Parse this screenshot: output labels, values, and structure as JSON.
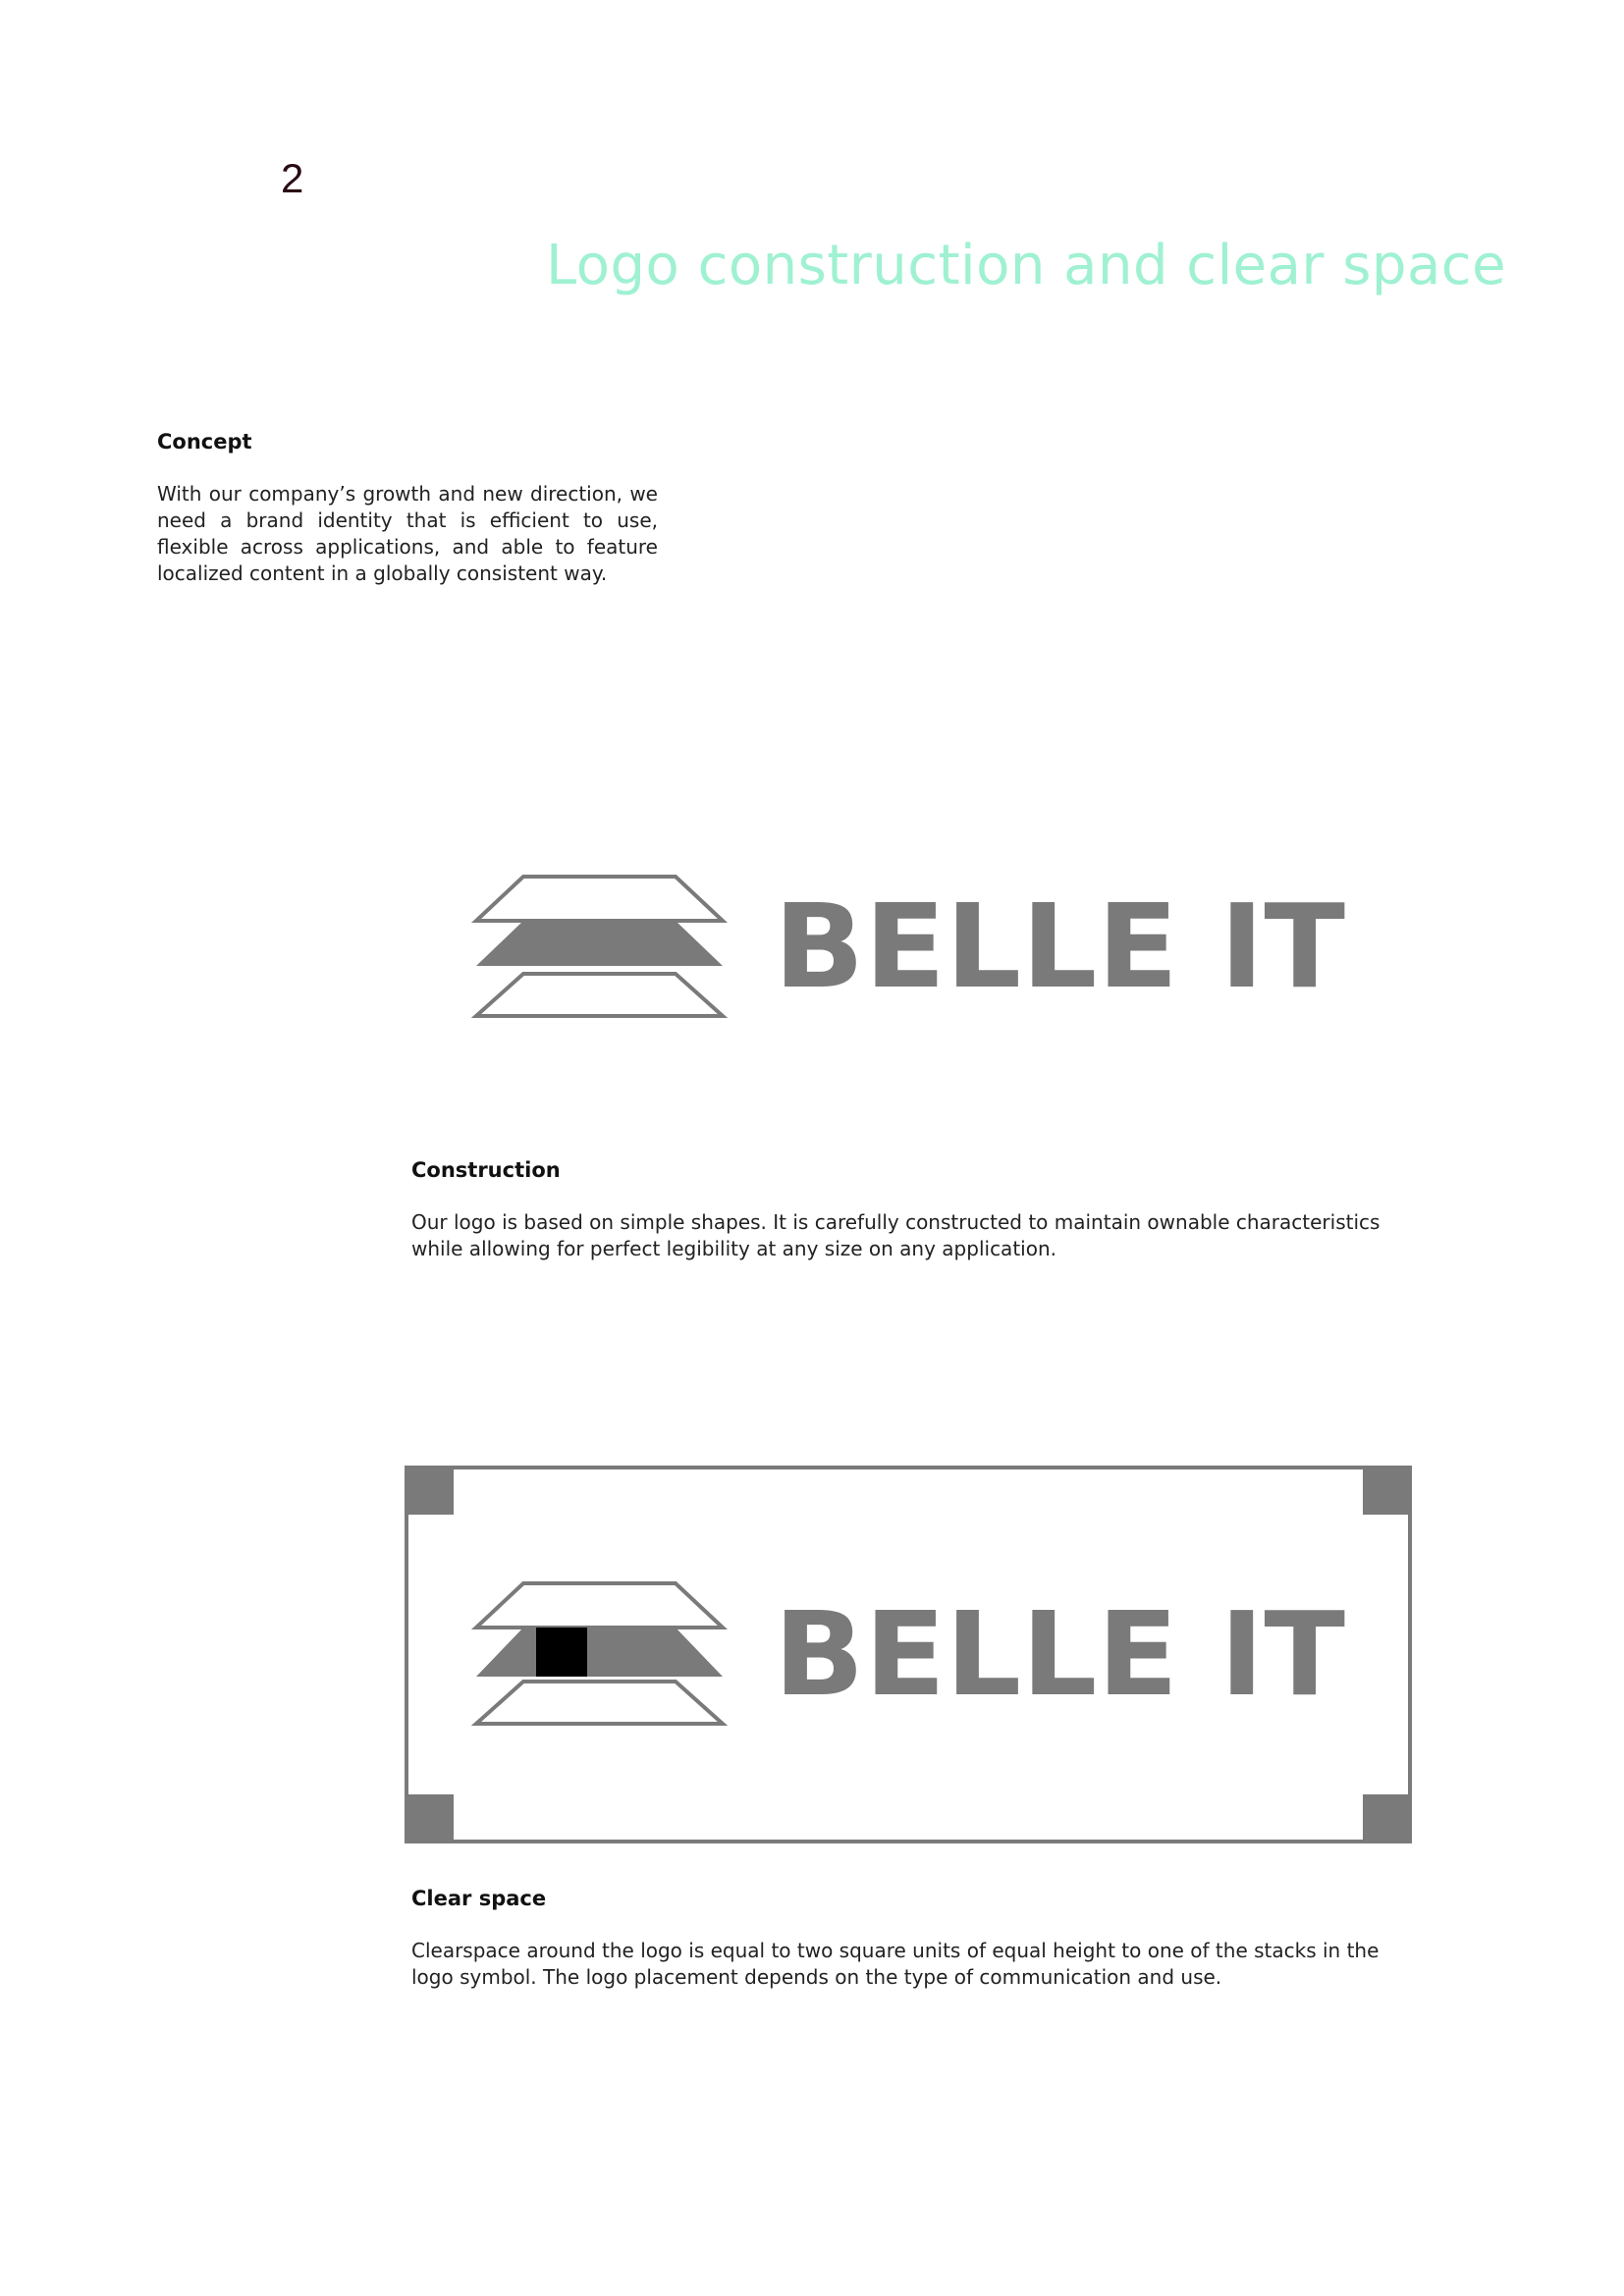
{
  "page": {
    "number": "2",
    "title": "Logo construction and clear space"
  },
  "concept": {
    "heading": "Concept",
    "body": "With our company’s growth and new direction, we need a brand identity that is efficient to use, flexible across applications, and able to feature localized content in a globally consistent way."
  },
  "logo": {
    "wordmark": "BELLE IT",
    "icon": "stacked-layers-icon"
  },
  "construction": {
    "heading": "Construction",
    "body": "Our logo is based on simple shapes. It is carefully constructed to maintain ownable characteristics while allowing for perfect legibility at any size on any application."
  },
  "clear_space": {
    "heading": "Clear space",
    "body": "Clearspace around the logo is equal to two square units of equal height to one of the stacks in the logo symbol. The logo placement depends on the type of communication and use."
  },
  "colors": {
    "title_accent": "#9ff1d2",
    "logo_gray": "#7a7a7a",
    "unit_square": "#000000"
  }
}
